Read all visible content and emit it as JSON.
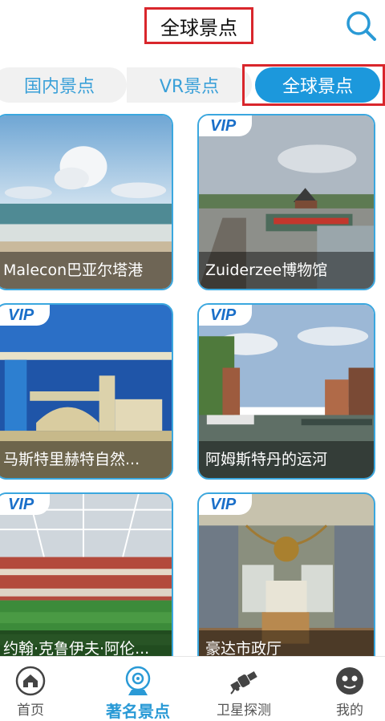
{
  "header": {
    "title": "全球景点",
    "search_icon": "search-icon"
  },
  "tabs": [
    {
      "label": "国内景点",
      "active": false
    },
    {
      "label": "VR景点",
      "active": false
    },
    {
      "label": "全球景点",
      "active": true
    }
  ],
  "cards": [
    {
      "title": "Malecon巴亚尔塔港",
      "vip": false
    },
    {
      "title": "Zuiderzee博物馆",
      "vip": "VIP"
    },
    {
      "title": "马斯特里赫特自然...",
      "vip": "VIP"
    },
    {
      "title": "阿姆斯特丹的运河",
      "vip": "VIP"
    },
    {
      "title": "约翰·克鲁伊夫·阿伦...",
      "vip": "VIP"
    },
    {
      "title": "豪达市政厅",
      "vip": "VIP"
    }
  ],
  "bottom_nav": [
    {
      "label": "首页",
      "icon": "home-icon",
      "active": false
    },
    {
      "label": "著名景点",
      "icon": "camera-icon",
      "active": true
    },
    {
      "label": "卫星探测",
      "icon": "satellite-icon",
      "active": false
    },
    {
      "label": "我的",
      "icon": "profile-icon",
      "active": false
    }
  ],
  "colors": {
    "accent": "#1c98dc",
    "highlight": "#d9262c",
    "vip": "#1a6fc9"
  }
}
